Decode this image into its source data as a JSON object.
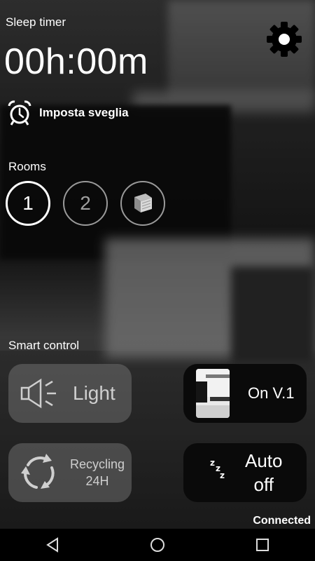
{
  "header": {
    "title": "Sleep timer",
    "timer_value": "00h:00m"
  },
  "alarm": {
    "label": "Imposta sveglia"
  },
  "rooms": {
    "label": "Rooms",
    "items": [
      "1",
      "2"
    ],
    "selected": "1"
  },
  "smart_control": {
    "label": "Smart control",
    "light": {
      "label": "Light"
    },
    "on_version": {
      "label": "On V.1"
    },
    "recycling": {
      "line1": "Recycling",
      "line2": "24H"
    },
    "auto_off": {
      "line1": "Auto",
      "line2": "off"
    }
  },
  "status": {
    "text": "Connected"
  },
  "colors": {
    "moon": "#f6c526",
    "tile_grey": "#6e6e6e",
    "tile_black": "#0a0a0a"
  },
  "icons": [
    "gear-icon",
    "alarm-clock-icon",
    "book-icon",
    "speaker-icon",
    "recycle-icon",
    "moon-sleep-icon",
    "back-icon",
    "home-icon",
    "recents-icon"
  ]
}
